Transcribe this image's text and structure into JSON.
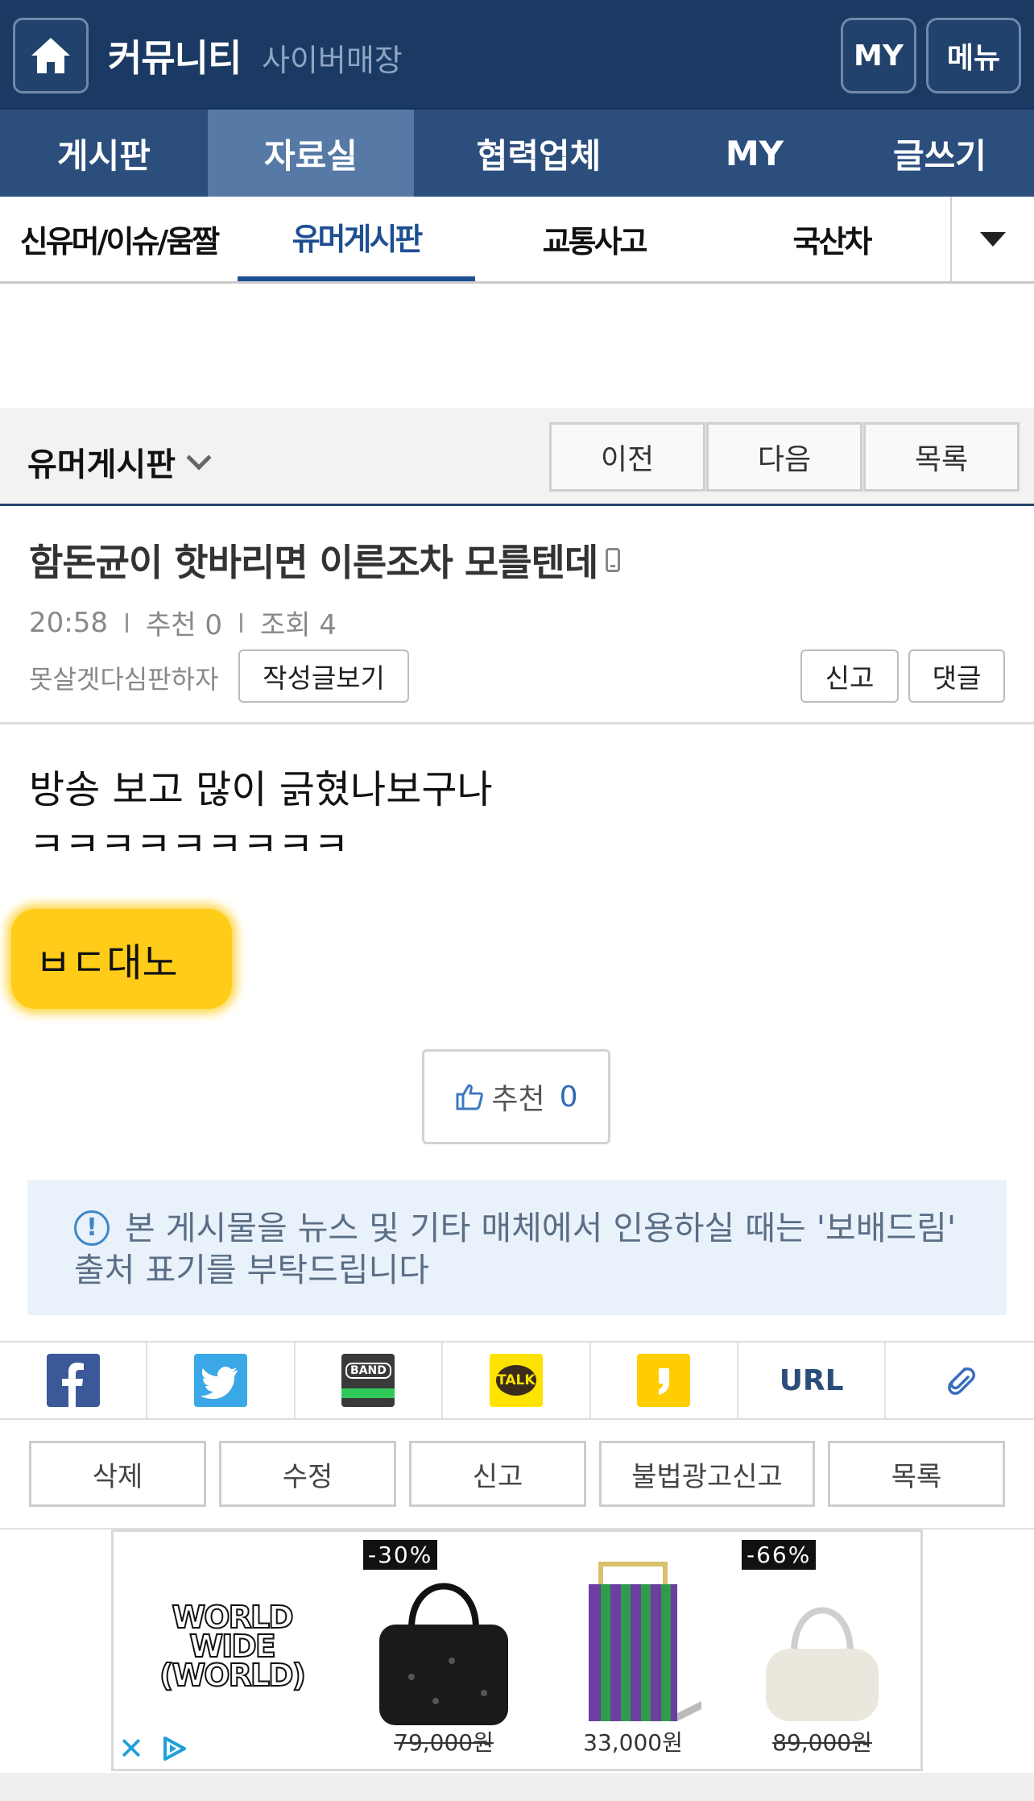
{
  "header": {
    "title": "커뮤니티",
    "subtitle": "사이버매장",
    "my_label": "MY",
    "menu_label": "메뉴"
  },
  "main_nav": [
    "게시판",
    "자료실",
    "협력업체",
    "MY",
    "글쓰기"
  ],
  "sub_nav": [
    "신유머/이슈/움짤",
    "유머게시판",
    "교통사고",
    "국산차"
  ],
  "board": {
    "name": "유머게시판",
    "prev": "이전",
    "next": "다음",
    "list": "목록"
  },
  "post": {
    "title": "함돈균이 핫바리면 이른조차 모를텐데",
    "time": "20:58",
    "recommend": "추천 0",
    "views": "조회 4",
    "author": "못살겟다심판하자",
    "view_posts": "작성글보기",
    "report": "신고",
    "comment": "댓글",
    "body_line1": "방송 보고 많이 긁혔나보구나",
    "body_line2": "ㅋㅋㅋㅋㅋㅋㅋㅋㅋ",
    "highlight": "ㅂㄷ대노"
  },
  "like": {
    "label": "추천",
    "count": "0"
  },
  "notice": {
    "line1": "본 게시물을 뉴스 및 기타 매체에서 인용하실 때는 '보배드림'",
    "line2": "출처 표기를 부탁드립니다"
  },
  "share": {
    "band": "BAND",
    "talk": "TALK",
    "url": "URL"
  },
  "actions": [
    "삭제",
    "수정",
    "신고",
    "불법광고신고",
    "목록"
  ],
  "ad": {
    "brand": [
      "WORLD",
      "WIDE",
      "(WORLD)"
    ],
    "items": [
      {
        "tag": "-30%",
        "price": "79,000원"
      },
      {
        "tag": "",
        "price": "33,000원"
      },
      {
        "tag": "-66%",
        "price": "89,000원"
      }
    ]
  },
  "colors": {
    "header_bg": "#1b3a63",
    "nav_bg": "#2b4e7d",
    "nav_active": "#5679a6",
    "accent": "#1e4f92",
    "highlight": "#ffcc19"
  }
}
